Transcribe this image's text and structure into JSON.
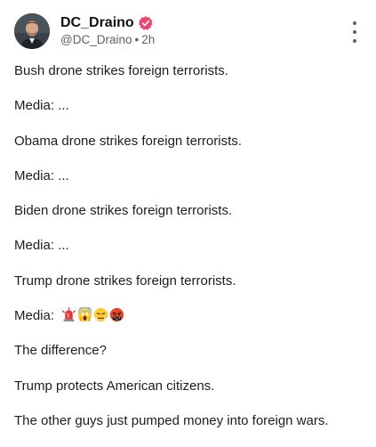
{
  "author": {
    "name": "DC_Draino",
    "handle": "@DC_Draino",
    "separator": "•",
    "time": "2h"
  },
  "colors": {
    "verified_badge": "#e8456f",
    "text": "#1d1d1f",
    "muted": "#5c6168"
  },
  "icons": {
    "verified": "verified-badge-icon",
    "more": "more-vertical-icon"
  },
  "post": {
    "lines": [
      "Bush drone strikes foreign terrorists.",
      "Media: ...",
      "Obama drone strikes foreign terrorists.",
      "Media: ...",
      "Biden drone strikes foreign terrorists.",
      "Media: ...",
      "Trump drone strikes foreign terrorists.",
      "Media:",
      "The difference?",
      "Trump protects American citizens.",
      "The other guys just pumped money into foreign wars."
    ],
    "emojis": [
      "siren-emoji",
      "screaming-face-emoji",
      "steam-from-nose-emoji",
      "cursing-face-emoji"
    ]
  }
}
